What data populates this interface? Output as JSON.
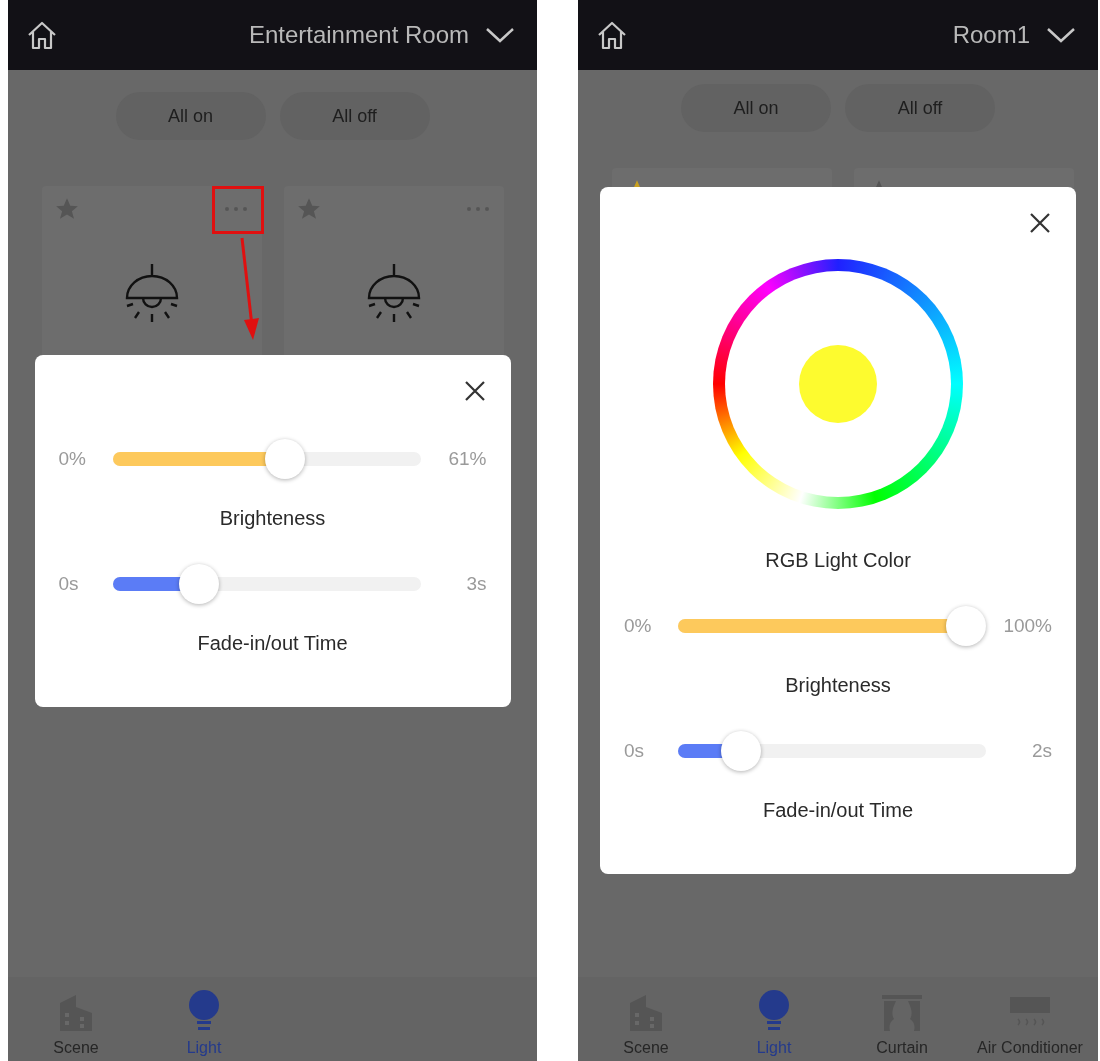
{
  "screens": [
    {
      "header": {
        "title": "Entertainment Room"
      },
      "actions": [
        "All on",
        "All off"
      ],
      "devices": [
        {
          "favorite": false,
          "highlighted": true
        },
        {
          "favorite": false,
          "highlighted": false
        }
      ],
      "dialog": {
        "sliders": [
          {
            "min": "0%",
            "max": "61%",
            "level": 0.6,
            "label": "Brighteness",
            "color": "#fdc95c"
          },
          {
            "min": "0s",
            "max": "3s",
            "level": 0.3,
            "label": "Fade-in/out Time",
            "color": "#5b7cf6"
          }
        ]
      },
      "tabs": [
        {
          "label": "Scene",
          "kind": "scene",
          "selected": false
        },
        {
          "label": "Light",
          "kind": "light",
          "selected": true
        }
      ]
    },
    {
      "header": {
        "title": "Room1"
      },
      "actions": [
        "All on",
        "All off"
      ],
      "devices": [
        {
          "favorite": true,
          "highlighted": false
        },
        {
          "favorite": false,
          "highlighted": false
        }
      ],
      "dialog": {
        "color_picker": {
          "label": "RGB Light Color",
          "color": "#fdfb2f"
        },
        "sliders": [
          {
            "min": "0%",
            "max": "100%",
            "level": 1,
            "label": "Brighteness",
            "color": "#fdc95c"
          },
          {
            "min": "0s",
            "max": "2s",
            "level": 0.22,
            "label": "Fade-in/out Time",
            "color": "#5b7cf6"
          }
        ]
      },
      "tabs": [
        {
          "label": "Scene",
          "kind": "scene",
          "selected": false
        },
        {
          "label": "Light",
          "kind": "light",
          "selected": true
        },
        {
          "label": "Curtain",
          "kind": "curtain",
          "selected": false
        },
        {
          "label": "Air Conditioner",
          "kind": "air_conditioner",
          "selected": false
        }
      ]
    }
  ]
}
